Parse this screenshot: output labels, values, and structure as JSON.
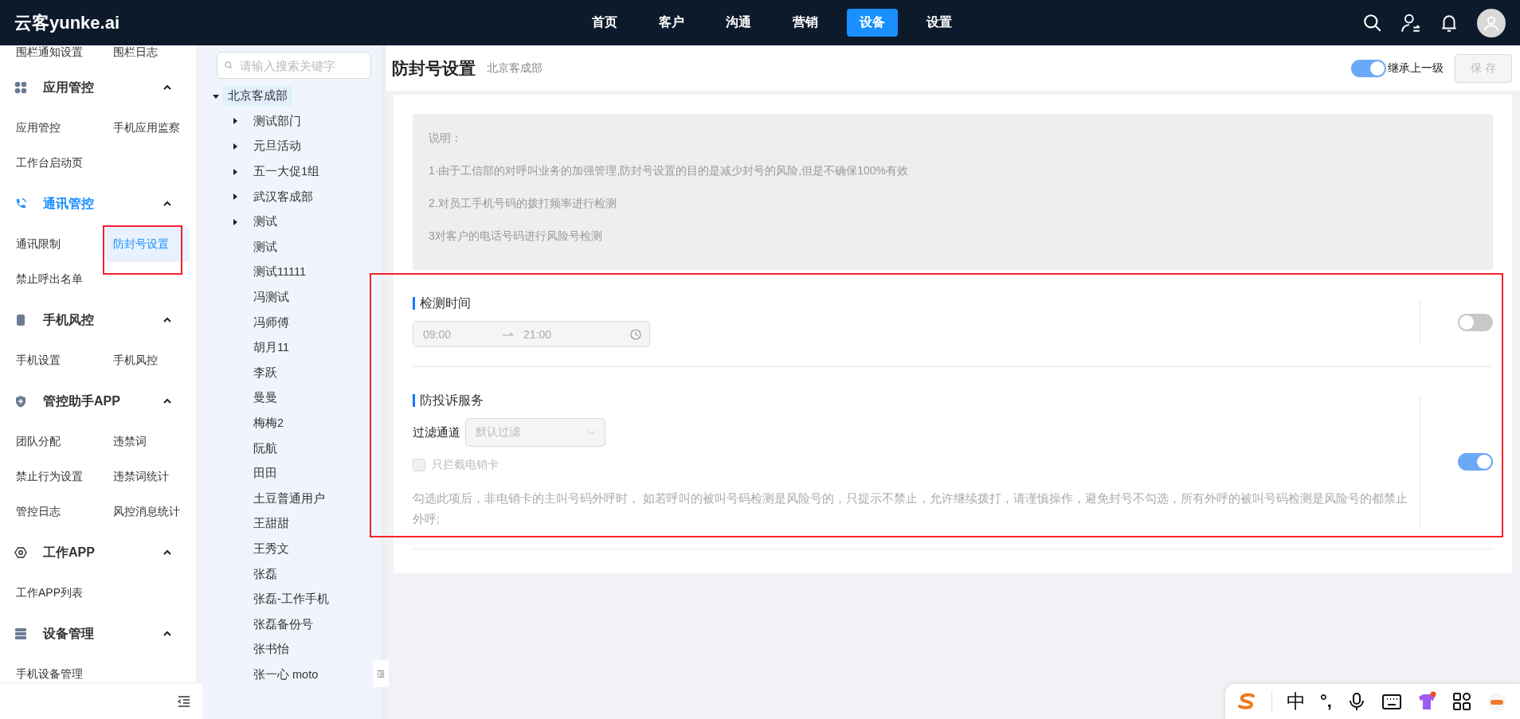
{
  "header": {
    "logo": "云客yunke.ai",
    "nav": [
      {
        "label": "首页",
        "selected": false
      },
      {
        "label": "客户",
        "selected": false
      },
      {
        "label": "沟通",
        "selected": false
      },
      {
        "label": "营销",
        "selected": false
      },
      {
        "label": "设备",
        "selected": true
      },
      {
        "label": "设置",
        "selected": false
      }
    ]
  },
  "sidebar": {
    "top_items": [
      "围栏通知设置",
      "围栏日志"
    ],
    "groups": [
      {
        "title": "应用管控",
        "kind": "apps",
        "selected": false,
        "expanded": true,
        "items": [
          {
            "label": "应用管控",
            "selected": false,
            "highlighted": false
          },
          {
            "label": "手机应用监察",
            "selected": false,
            "highlighted": false
          },
          {
            "label": "工作台启动页",
            "selected": false,
            "highlighted": false
          }
        ]
      },
      {
        "title": "通讯管控",
        "kind": "phone",
        "selected": true,
        "expanded": true,
        "items": [
          {
            "label": "通讯限制",
            "selected": false,
            "highlighted": false
          },
          {
            "label": "防封号设置",
            "selected": true,
            "highlighted": true
          },
          {
            "label": "禁止呼出名单",
            "selected": false,
            "highlighted": false
          }
        ]
      },
      {
        "title": "手机风控",
        "kind": "mobile",
        "selected": false,
        "expanded": true,
        "items": [
          {
            "label": "手机设置",
            "selected": false,
            "highlighted": false
          },
          {
            "label": "手机风控",
            "selected": false,
            "highlighted": false
          }
        ]
      },
      {
        "title": "管控助手APP",
        "kind": "shield",
        "selected": false,
        "expanded": true,
        "items": [
          {
            "label": "团队分配",
            "selected": false,
            "highlighted": false
          },
          {
            "label": "违禁词",
            "selected": false,
            "highlighted": false
          },
          {
            "label": "禁止行为设置",
            "selected": false,
            "highlighted": false
          },
          {
            "label": "违禁词统计",
            "selected": false,
            "highlighted": false
          },
          {
            "label": "管控日志",
            "selected": false,
            "highlighted": false
          },
          {
            "label": "风控消息统计",
            "selected": false,
            "highlighted": false
          }
        ]
      },
      {
        "title": "工作APP",
        "kind": "hexagon",
        "selected": false,
        "expanded": true,
        "items": [
          {
            "label": "工作APP列表",
            "selected": false,
            "highlighted": false
          }
        ]
      },
      {
        "title": "设备管理",
        "kind": "server",
        "selected": false,
        "expanded": true,
        "items": [
          {
            "label": "手机设备管理",
            "selected": false,
            "highlighted": false
          }
        ]
      }
    ]
  },
  "tree": {
    "search": {
      "placeholder": "请输入搜索关键字"
    },
    "root": {
      "label": "北京客成部",
      "expanded": true,
      "selected": true,
      "children": [
        {
          "label": "测试部门",
          "expanded": false,
          "selected": false
        },
        {
          "label": "元旦活动",
          "expanded": false,
          "selected": false
        },
        {
          "label": "五一大促1组",
          "expanded": false,
          "selected": false
        },
        {
          "label": "武汉客成部",
          "expanded": false,
          "selected": false
        },
        {
          "label": "测试",
          "expanded": false,
          "selected": false
        },
        {
          "label": "测试",
          "selected": false
        },
        {
          "label": "测试11111",
          "selected": false
        },
        {
          "label": "冯测试",
          "selected": false
        },
        {
          "label": "冯师傅",
          "selected": false
        },
        {
          "label": "胡月11",
          "selected": false
        },
        {
          "label": "李跃",
          "selected": false
        },
        {
          "label": "曼曼",
          "selected": false
        },
        {
          "label": "梅梅2",
          "selected": false
        },
        {
          "label": "阮航",
          "selected": false
        },
        {
          "label": "田田",
          "selected": false
        },
        {
          "label": "土豆普通用户",
          "selected": false
        },
        {
          "label": "王甜甜",
          "selected": false
        },
        {
          "label": "王秀文",
          "selected": false
        },
        {
          "label": "张磊",
          "selected": false
        },
        {
          "label": "张磊-工作手机",
          "selected": false
        },
        {
          "label": "张磊备份号",
          "selected": false
        },
        {
          "label": "张书怡",
          "selected": false
        },
        {
          "label": "张一心 moto",
          "selected": false
        }
      ]
    }
  },
  "page": {
    "title": "防封号设置",
    "subtitle": "北京客成部",
    "inherit": {
      "label": "继承上一级",
      "on": true
    },
    "save": {
      "label": "保 存",
      "disabled": true
    }
  },
  "notice": {
    "lines": [
      "说明：",
      "1·由于工信部的对呼叫业务的加强管理,防封号设置的目的是减少封号的风险,但是不确保100%有效",
      "2.对员工手机号码的拨打频率进行检测",
      "3对客户的电话号码进行风险号检测"
    ]
  },
  "settings": {
    "highlighted": true,
    "sections": [
      {
        "kind": "time_range",
        "title": "检测时间",
        "on": false,
        "start": "09:00",
        "end": "21:00",
        "disabled": true
      },
      {
        "kind": "filter",
        "title": "防投诉服务",
        "on": true,
        "field_label": "过滤通道",
        "select": {
          "placeholder": "默认过滤",
          "disabled": true
        },
        "checkbox": {
          "label": "只拦截电销卡",
          "checked": false,
          "disabled": true
        },
        "note": "勾选此项后，非电销卡的主叫号码外呼时， 如若呼叫的被叫号码检测是风险号的，只提示不禁止，允许继续拨打，请谨慎操作，避免封号不勾选，所有外呼的被叫号码检测是风险号的都禁止外呼;"
      }
    ]
  },
  "ime_bar": {
    "mode": "中",
    "punctuation": "°,"
  }
}
